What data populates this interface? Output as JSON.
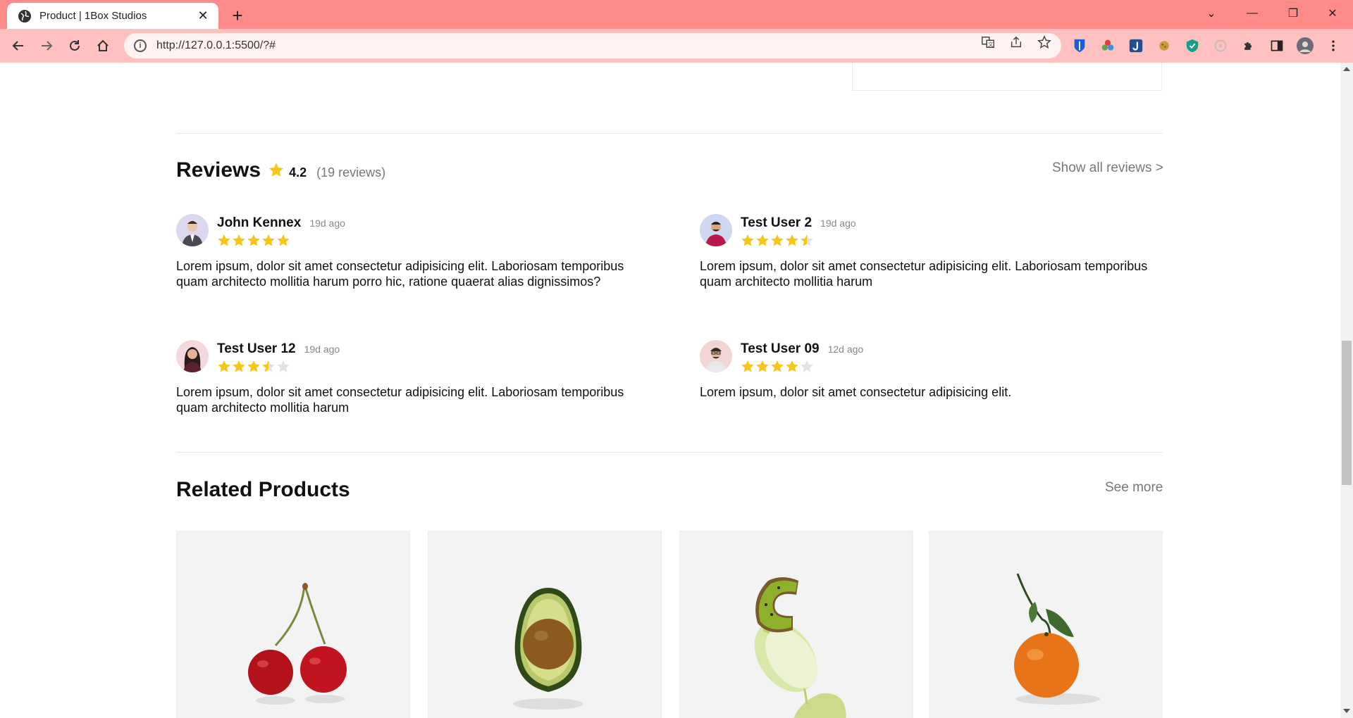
{
  "browser": {
    "tab_title": "Product | 1Box Studios",
    "url": "http://127.0.0.1:5500/?#"
  },
  "reviews": {
    "title": "Reviews",
    "rating": "4.2",
    "count_label": "(19 reviews)",
    "show_all_label": "Show all reviews >",
    "items": [
      {
        "name": "John Kennex",
        "time": "19d ago",
        "stars": 5,
        "text": "Lorem ipsum, dolor sit amet consectetur adipisicing elit. Laboriosam temporibus quam architecto mollitia harum porro hic, ratione quaerat alias dignissimos?"
      },
      {
        "name": "Test User 2",
        "time": "19d ago",
        "stars": 4.5,
        "text": "Lorem ipsum, dolor sit amet consectetur adipisicing elit. Laboriosam temporibus quam architecto mollitia harum"
      },
      {
        "name": "Test User 12",
        "time": "19d ago",
        "stars": 3.5,
        "text": "Lorem ipsum, dolor sit amet consectetur adipisicing elit. Laboriosam temporibus quam architecto mollitia harum"
      },
      {
        "name": "Test User 09",
        "time": "12d ago",
        "stars": 4,
        "text": "Lorem ipsum, dolor sit amet consectetur adipisicing elit."
      }
    ]
  },
  "related": {
    "title": "Related Products",
    "see_more_label": "See more",
    "products": [
      {
        "image": "cherries-image"
      },
      {
        "image": "avocado-image"
      },
      {
        "image": "kiwi-lime-image"
      },
      {
        "image": "tangerine-image"
      }
    ]
  },
  "colors": {
    "tabbar": "#ff8a8a",
    "toolbar": "#ffc0c0",
    "star": "#f5c518",
    "star_empty": "#e2e2e2"
  }
}
